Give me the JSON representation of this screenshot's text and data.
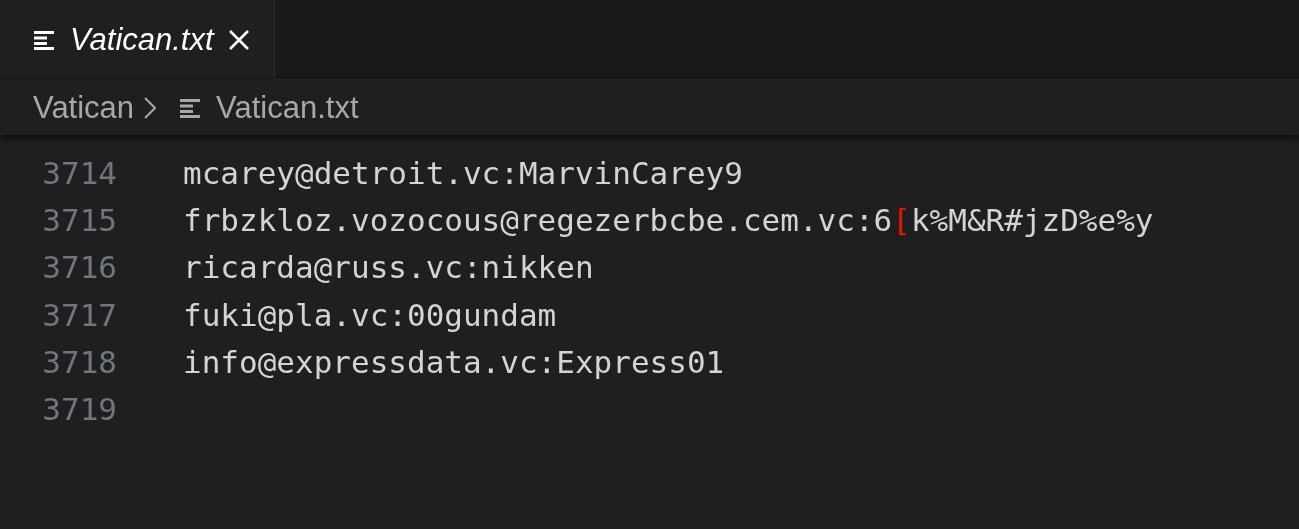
{
  "tabs": [
    {
      "label": "Vatican.txt",
      "selected": true,
      "italic": true
    }
  ],
  "breadcrumb": [
    {
      "label": "Vatican",
      "kind": "folder"
    },
    {
      "label": "Vatican.txt",
      "kind": "file"
    }
  ],
  "lines": [
    {
      "number": "3714",
      "segments": [
        {
          "text": "mcarey@detroit.vc:MarvinCarey9",
          "error": false
        }
      ]
    },
    {
      "number": "3715",
      "segments": [
        {
          "text": "frbzkloz.vozocous@regezerbcbe.cem.vc:6",
          "error": false
        },
        {
          "text": "[",
          "error": true
        },
        {
          "text": "k%M&R#jzD%e%y",
          "error": false
        }
      ]
    },
    {
      "number": "3716",
      "segments": [
        {
          "text": "ricarda@russ.vc:nikken",
          "error": false
        }
      ]
    },
    {
      "number": "3717",
      "segments": [
        {
          "text": "fuki@pla.vc:00gundam",
          "error": false
        }
      ]
    },
    {
      "number": "3718",
      "segments": [
        {
          "text": "info@expressdata.vc:Express01",
          "error": false
        }
      ]
    },
    {
      "number": "3719"
    }
  ]
}
